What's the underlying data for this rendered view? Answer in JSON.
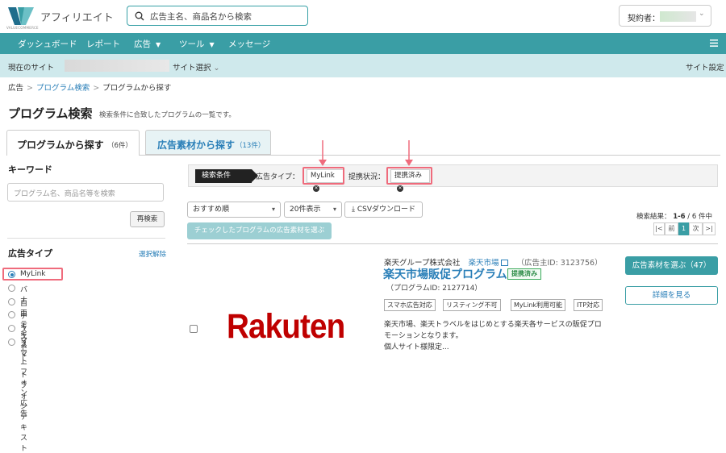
{
  "header": {
    "brand": "アフィリエイト",
    "logo_sub": "VALUECOMMERCE",
    "search_placeholder": "広告主名、商品名から検索",
    "account_label": "契約者："
  },
  "nav": {
    "items": [
      "ダッシュボード",
      "レポート",
      "広告",
      "ツール",
      "メッセージ"
    ]
  },
  "sitebar": {
    "current_site": "現在のサイト",
    "site_select": "サイト選択",
    "site_settings": "サイト設定"
  },
  "breadcrumb": {
    "home": "広告",
    "search": "プログラム検索",
    "current": "プログラムから探す"
  },
  "page": {
    "title": "プログラム検索",
    "description": "検索条件に合致したプログラムの一覧です。"
  },
  "tabs": [
    {
      "label": "プログラムから探す",
      "count": "（6件）"
    },
    {
      "label": "広告素材から探す",
      "count": "（13件）"
    }
  ],
  "sidebar": {
    "keyword_title": "キーワード",
    "keyword_placeholder": "プログラム名、商品名等を検索",
    "research_label": "再検索",
    "ad_type_title": "広告タイプ",
    "clear_label": "選択解除",
    "options": [
      "MyLink",
      "バナー",
      "自由テキスト",
      "テキスト",
      "スマートフォン広告",
      "スマートフォンテキスト"
    ]
  },
  "filter": {
    "badge": "検索条件",
    "type_label": "広告タイプ：",
    "type_value": "MyLink",
    "status_label": "提携状況：",
    "status_value": "提携済み"
  },
  "controls": {
    "sort": "おすすめ順",
    "per_page": "20件表示",
    "csv": "CSVダウンロード",
    "check_button": "チェックしたプログラムの広告素材を選ぶ",
    "result_label": "検索結果：",
    "result_range": "1-6",
    "result_total": "/ 6 件中",
    "pager": [
      "|<",
      "前",
      "1",
      "次",
      ">|"
    ]
  },
  "program": {
    "company": "楽天グループ株式会社",
    "shop": "楽天市場",
    "advertiser_id": "（広告主ID: 3123756）",
    "name": "楽天市場販促プログラム",
    "partner_badge": "提携済み",
    "program_id": "（プログラムID: 2127714）",
    "tags": [
      "スマホ広告対応",
      "リスティング不可",
      "MyLink利用可能",
      "ITP対応"
    ],
    "desc_lines": [
      "楽天市場、楽天トラベルをはじめとする楽天各サービスの販促プロ",
      "モーションとなります。",
      "個人サイト様限定..."
    ],
    "logo_text": "Rakuten",
    "select_button": "広告素材を選ぶ（47）",
    "detail_button": "詳細を見る"
  },
  "colors": {
    "teal": "#3a9ea5",
    "link": "#2a7fb8",
    "highlight": "#ef6b7c",
    "rakuten_red": "#bf0000"
  }
}
